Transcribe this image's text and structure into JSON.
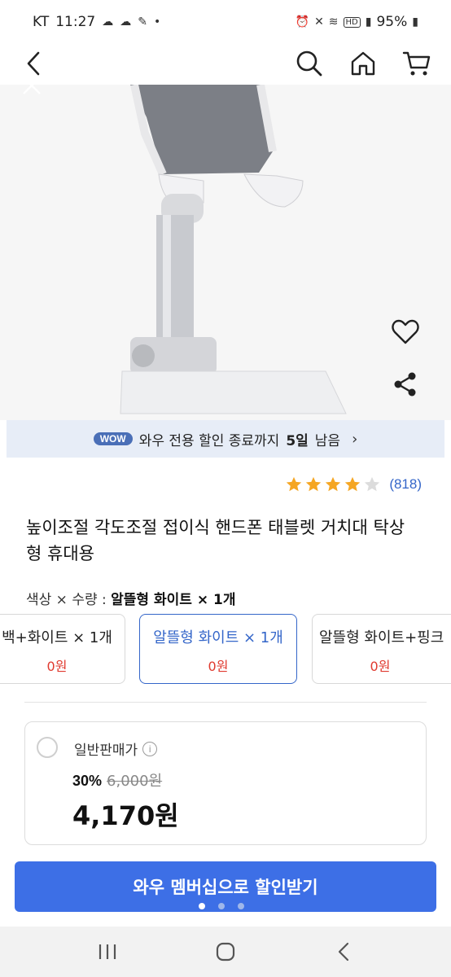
{
  "status_bar": {
    "carrier": "KT",
    "time": "11:27",
    "battery": "95%",
    "network": "HD"
  },
  "header": {
    "icons": [
      "back-arrow-icon",
      "search-icon",
      "home-icon",
      "cart-icon"
    ]
  },
  "hero": {
    "icons": [
      "close-icon",
      "heart-icon",
      "share-icon"
    ]
  },
  "wow_banner": {
    "badge": "WOW",
    "text_before": "와우 전용 할인 종료까지",
    "days": "5일",
    "text_after": "남음"
  },
  "rating": {
    "stars": 4,
    "max_stars": 5,
    "review_count": "(818)"
  },
  "product": {
    "title": "높이조절 각도조절 접이식 핸드폰 태블렛 거치대 탁상형 휴대용"
  },
  "option": {
    "label": "색상 × 수량 :",
    "selected": "알뜰형 화이트 × 1개",
    "cards": [
      {
        "name": "백+화이트 × 1개",
        "price": "0원"
      },
      {
        "name": "알뜰형 화이트 × 1개",
        "price": "0원"
      },
      {
        "name": "알뜰형 화이트+핑크",
        "price": "0원"
      }
    ]
  },
  "price_box": {
    "label": "일반판매가",
    "info_glyph": "i",
    "discount_rate": "30%",
    "original_price": "6,000원",
    "sale_price": "4,170원"
  },
  "cta": {
    "label": "와우 멤버십으로 할인받기"
  },
  "colors": {
    "accent": "#3466c9",
    "cta": "#3d6fe6",
    "star": "#f5a623",
    "price_red": "#e03a2f",
    "banner_bg": "#e7edf7"
  }
}
